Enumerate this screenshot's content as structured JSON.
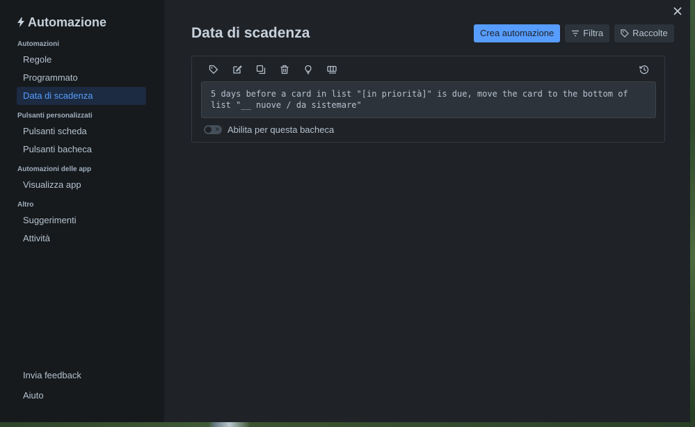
{
  "sidebar": {
    "title": "Automazione",
    "groups": [
      {
        "label": "Automazioni",
        "items": [
          {
            "label": "Regole"
          },
          {
            "label": "Programmato"
          },
          {
            "label": "Data di scadenza"
          }
        ]
      },
      {
        "label": "Pulsanti personalizzati",
        "items": [
          {
            "label": "Pulsanti scheda"
          },
          {
            "label": "Pulsanti bacheca"
          }
        ]
      },
      {
        "label": "Automazioni delle app",
        "items": [
          {
            "label": "Visualizza app"
          }
        ]
      },
      {
        "label": "Altro",
        "items": [
          {
            "label": "Suggerimenti"
          },
          {
            "label": "Attività"
          }
        ]
      }
    ],
    "active_item": "Data di scadenza",
    "bottom": {
      "feedback": "Invia feedback",
      "help": "Aiuto"
    }
  },
  "main": {
    "title": "Data di scadenza",
    "buttons": {
      "create": "Crea automazione",
      "filter": "Filtra",
      "collections": "Raccolte"
    },
    "rule": {
      "text": "5 days before a card in list \"[in priorità]\" is due, move the card to the bottom of list \"__ nuove / da sistemare\"",
      "toggle_label": "Abilita per questa bacheca",
      "enabled": false,
      "toolbar_icons": [
        "tag-icon",
        "edit-icon",
        "copy-icon",
        "trash-icon",
        "lightbulb-icon",
        "board-icon"
      ]
    }
  },
  "colors": {
    "accent": "#579dff",
    "sidebar_bg": "#161a1d",
    "main_bg": "#1f2226",
    "active_bg": "#1c2b41"
  }
}
